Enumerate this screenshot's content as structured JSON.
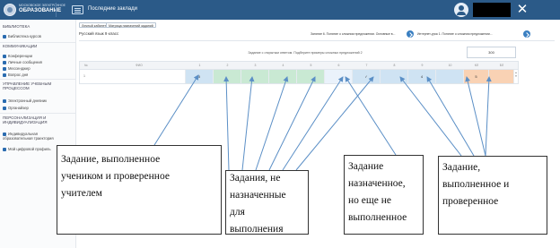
{
  "topbar": {
    "logo_small": "МОСКОВСКОЕ ЭЛЕКТРОННОЕ",
    "logo_big": "ОБРАЗОВАНИЕ",
    "title": "Последние заклади"
  },
  "sidebar": {
    "sections": [
      {
        "label": "БИБЛИОТЕКА",
        "items": [
          "Библиотека курсов"
        ]
      },
      {
        "label": "КОММУНИКАЦИИ",
        "items": [
          "Конференции",
          "Личные сообщения",
          "Мессенджер",
          "Вопрос дня"
        ]
      },
      {
        "label": "УПРАВЛЕНИЕ УЧЕБНЫМ ПРОЦЕССОМ",
        "items": [
          "Электронный дневник",
          "Органайзер"
        ]
      },
      {
        "label": "ПЕРСОНАЛИЗАЦИЯ И ИНДИВИДУАЛИЗАЦИЯ",
        "items": [
          "Индивидуальная образовательная траектория",
          "Мой цифровой профиль"
        ]
      }
    ]
  },
  "main": {
    "tabs": [
      "Личный кабинет",
      "Матрица назначений заданий"
    ],
    "breadcrumb": "Русский язык 9 класс",
    "filter1": "Занятие 6. Понятие о сложном предложении. Основные в...",
    "filter2": "Интернет-урок 1. Понятие о сложном предложении..."
  },
  "table": {
    "title": "Задание с открытым ответом. Подберите примеры сложных предложений 2",
    "search_value": "300",
    "headers": [
      "№",
      "ФИО",
      "1",
      "2",
      "3",
      "4",
      "5",
      "6",
      "7",
      "8",
      "9",
      "10",
      "КЛ",
      "БЛ"
    ],
    "row_num": "1",
    "cells": [
      {
        "status": "done",
        "value": "5"
      },
      {
        "status": "none",
        "value": ""
      },
      {
        "status": "none",
        "value": ""
      },
      {
        "status": "none",
        "value": ""
      },
      {
        "status": "none",
        "value": ""
      },
      {
        "status": "assigned",
        "value": ""
      },
      {
        "status": "done",
        "value": "✓"
      },
      {
        "status": "done",
        "value": ""
      },
      {
        "status": "done",
        "value": "4"
      },
      {
        "status": "done",
        "value": ""
      },
      {
        "status": "checked",
        "value": "5"
      },
      {
        "status": "checked",
        "value": ""
      }
    ],
    "status_colors": {
      "done": "#cfe3f3",
      "none": "#c9e9d3",
      "assigned": "#eaf2fb",
      "checked": "#f9d2b4"
    }
  },
  "callouts": [
    {
      "text": "Задание, выполненное\nучеником и проверенное\nучителем"
    },
    {
      "text": "Задания, не\nназначенные\nдля\nвыполнения"
    },
    {
      "text": "Задание\nназначенное,\nно еще не\nвыполненное"
    },
    {
      "text": "Задание,\nвыполненное и\nпроверенное"
    }
  ]
}
